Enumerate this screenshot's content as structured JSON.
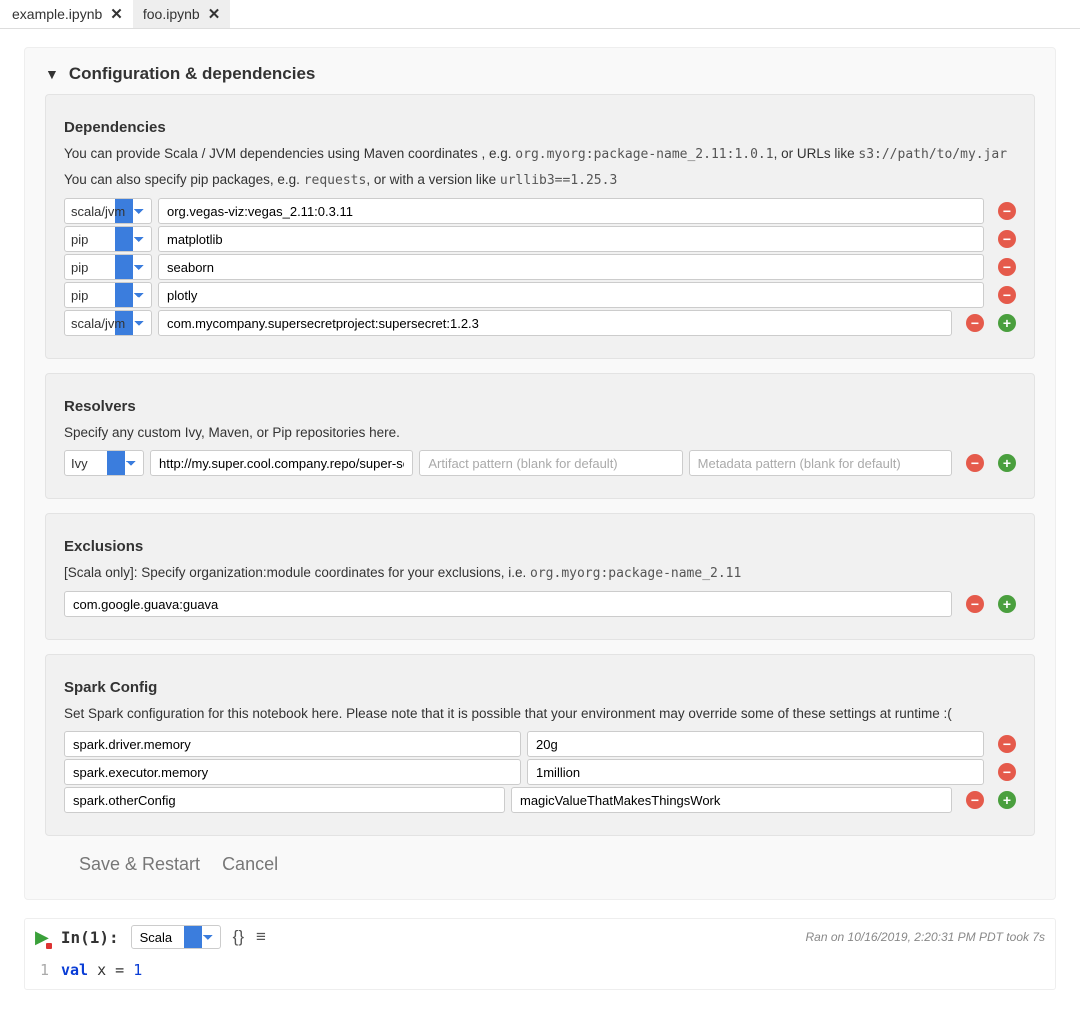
{
  "tabs": [
    {
      "label": "example.ipynb",
      "active": true
    },
    {
      "label": "foo.ipynb",
      "active": false
    }
  ],
  "config": {
    "header": "Configuration & dependencies",
    "dependencies": {
      "title": "Dependencies",
      "desc_a": "You can provide Scala / JVM dependencies using Maven coordinates , e.g.",
      "desc_a_code": "org.myorg:package-name_2.11:1.0.1",
      "desc_a_tail": ", or URLs like",
      "desc_a_code2": "s3://path/to/my.jar",
      "desc_b": "You can also specify pip packages, e.g.",
      "desc_b_code": "requests",
      "desc_b_mid": ", or with a version like",
      "desc_b_code2": "urllib3==1.25.3",
      "rows": [
        {
          "type": "scala/jvm",
          "value": "org.vegas-viz:vegas_2.11:0.3.11"
        },
        {
          "type": "pip",
          "value": "matplotlib"
        },
        {
          "type": "pip",
          "value": "seaborn"
        },
        {
          "type": "pip",
          "value": "plotly"
        },
        {
          "type": "scala/jvm",
          "value": "com.mycompany.supersecretproject:supersecret:1.2.3"
        }
      ]
    },
    "resolvers": {
      "title": "Resolvers",
      "desc": "Specify any custom Ivy, Maven, or Pip repositories here.",
      "rows": [
        {
          "type": "Ivy",
          "url": "http://my.super.cool.company.repo/super-secret-releases",
          "artifact_placeholder": "Artifact pattern (blank for default)",
          "metadata_placeholder": "Metadata pattern (blank for default)"
        }
      ]
    },
    "exclusions": {
      "title": "Exclusions",
      "desc_a": "[Scala only]: Specify organization:module coordinates for your exclusions, i.e.",
      "desc_code": "org.myorg:package-name_2.11",
      "rows": [
        {
          "value": "com.google.guava:guava"
        }
      ]
    },
    "spark": {
      "title": "Spark Config",
      "desc": "Set Spark configuration for this notebook here. Please note that it is possible that your environment may override some of these settings at runtime :(",
      "rows": [
        {
          "key": "spark.driver.memory",
          "value": "20g"
        },
        {
          "key": "spark.executor.memory",
          "value": "1million"
        },
        {
          "key": "spark.otherConfig",
          "value": "magicValueThatMakesThingsWork"
        }
      ]
    },
    "buttons": {
      "save": "Save & Restart",
      "cancel": "Cancel"
    }
  },
  "cell": {
    "in_label": "In(1):",
    "language": "Scala",
    "status": "Ran on 10/16/2019, 2:20:31 PM PDT took 7s",
    "code_line": "1",
    "code_kw": "val",
    "code_rest": " x = ",
    "code_num": "1"
  }
}
